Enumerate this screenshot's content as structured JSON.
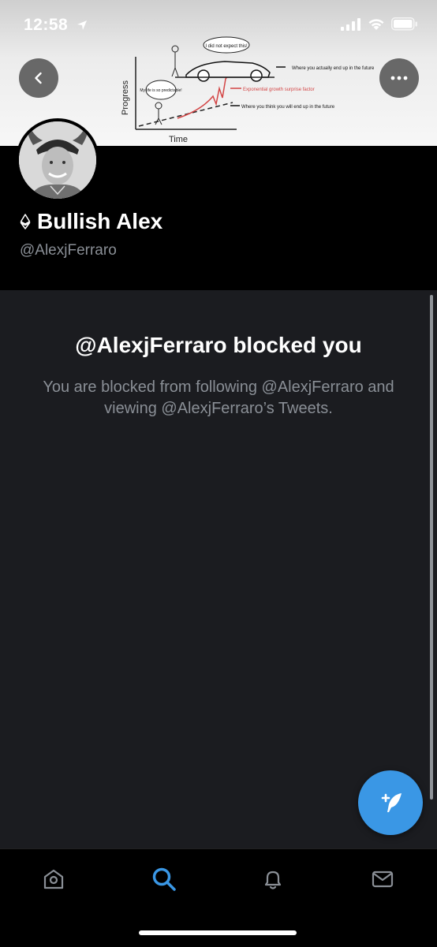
{
  "status_bar": {
    "time": "12:58"
  },
  "banner": {
    "speech_top": "I did not expect this!",
    "speech_left": "My life is so predictable!",
    "note_1": "Where you actually end up in the future",
    "note_2": "Exponential growth surprise factor",
    "note_3": "Where you think you will end up in the future",
    "y_axis": "Progress",
    "x_axis": "Time"
  },
  "profile": {
    "display_name": "Bullish Alex",
    "handle": "@AlexjFerraro"
  },
  "blocked": {
    "title": "@AlexjFerraro blocked you",
    "description": "You are blocked from following @AlexjFerraro and viewing @AlexjFerraro’s Tweets."
  },
  "tabs": [
    {
      "name": "home",
      "icon": "home-icon"
    },
    {
      "name": "search",
      "icon": "search-icon"
    },
    {
      "name": "notifications",
      "icon": "bell-icon"
    },
    {
      "name": "messages",
      "icon": "envelope-icon"
    }
  ],
  "colors": {
    "accent": "#3a97e5",
    "content_bg": "#1b1c20",
    "muted_text": "#8a8f96"
  }
}
